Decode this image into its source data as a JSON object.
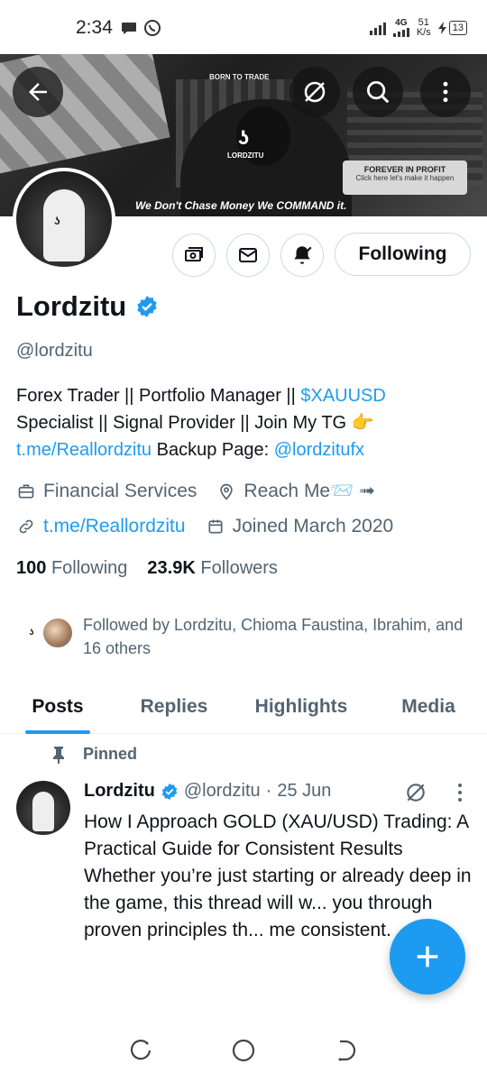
{
  "status_bar": {
    "time": "2:34",
    "network": "4G",
    "speed_value": "51",
    "speed_unit": "K/s",
    "battery": "13"
  },
  "banner": {
    "top_text": "BORN TO TRADE",
    "logo_text": "LORDZITU",
    "caption": "We Don't Chase Money We COMMAND it.",
    "profit_title": "FOREVER IN PROFIT",
    "profit_sub": "Click here let's make it happen"
  },
  "profile": {
    "name": "Lordzitu",
    "handle": "@lordzitu",
    "following_label": "Following",
    "bio_line1_text": "Forex Trader || Portfolio Manager || ",
    "bio_line1_link": "$XAUUSD",
    "bio_line2": "Specialist || Signal Provider || Join My TG 👉",
    "bio_line3_link1": "t.me/Reallordzitu",
    "bio_line3_text": " Backup Page: ",
    "bio_line3_link2": "@lordzitufx",
    "category": "Financial Services",
    "location": "Reach Me📨 ➟",
    "website": "t.me/Reallordzitu",
    "joined": "Joined March 2020",
    "following_count": "100",
    "following_word": "Following",
    "followers_count": "23.9K",
    "followers_word": "Followers",
    "followed_by": "Followed by Lordzitu, Chioma Faustina, Ibrahim, and 16 others"
  },
  "tabs": [
    {
      "label": "Posts",
      "active": true
    },
    {
      "label": "Replies",
      "active": false
    },
    {
      "label": "Highlights",
      "active": false
    },
    {
      "label": "Media",
      "active": false
    }
  ],
  "tweet": {
    "pinned_label": "Pinned",
    "author": "Lordzitu",
    "handle": "@lordzitu",
    "separator": "·",
    "date": "25 Jun",
    "text_p1": "How I Approach GOLD (XAU/USD) Trading: A Practical Guide for Consistent Results",
    "text_p2": "Whether you’re just starting or already deep in the game, this thread will w... you through proven principles th... me consistent."
  },
  "colors": {
    "accent": "#1d9bf0",
    "text_primary": "#0f1419",
    "text_secondary": "#536471"
  }
}
